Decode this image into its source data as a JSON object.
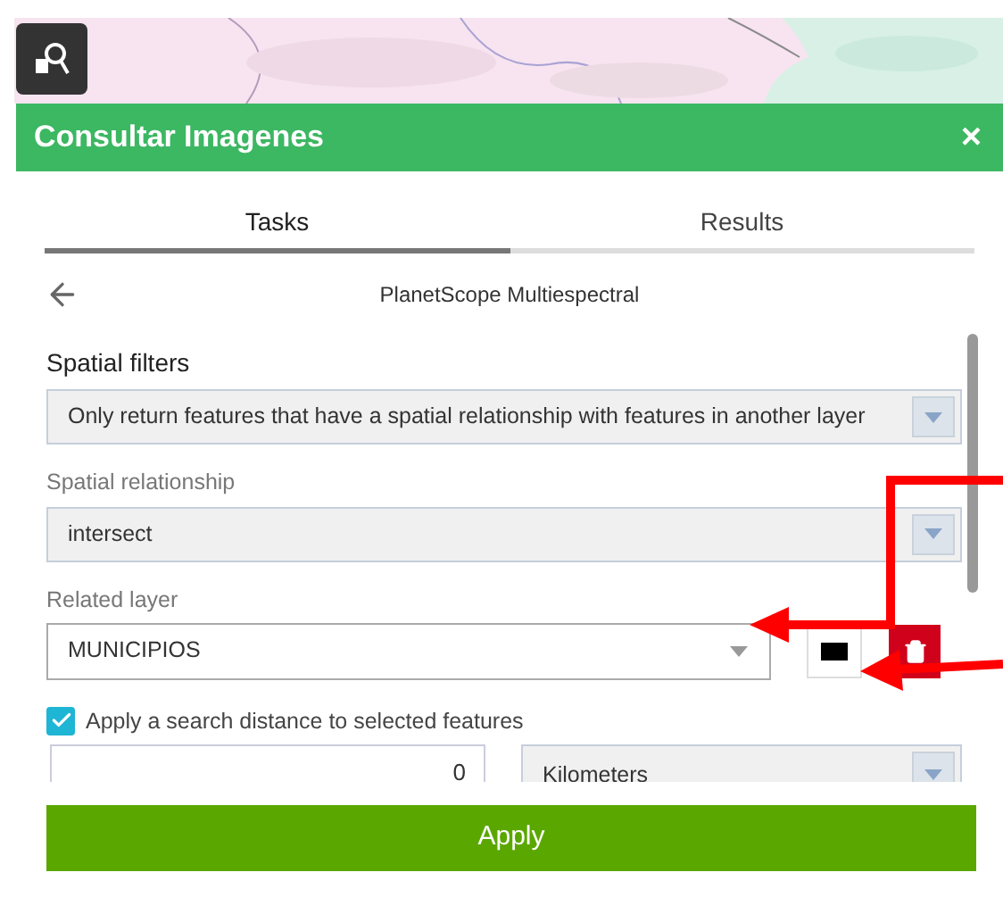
{
  "panel": {
    "title": "Consultar Imagenes",
    "close": "×"
  },
  "tabs": [
    {
      "label": "Tasks",
      "selected": true
    },
    {
      "label": "Results",
      "selected": false
    }
  ],
  "task_title": "PlanetScope Multiespectral",
  "section_title": "Spatial filters",
  "filter_mode": {
    "value": "Only return features that have a spatial relationship with features in another layer"
  },
  "spatial_relationship": {
    "label": "Spatial relationship",
    "value": "intersect"
  },
  "related_layer": {
    "label": "Related layer",
    "value": "MUNICIPIOS"
  },
  "search_distance": {
    "label": "Apply a search distance to selected features",
    "checked": true,
    "value": "0",
    "unit": "Kilometers"
  },
  "apply_button": "Apply"
}
